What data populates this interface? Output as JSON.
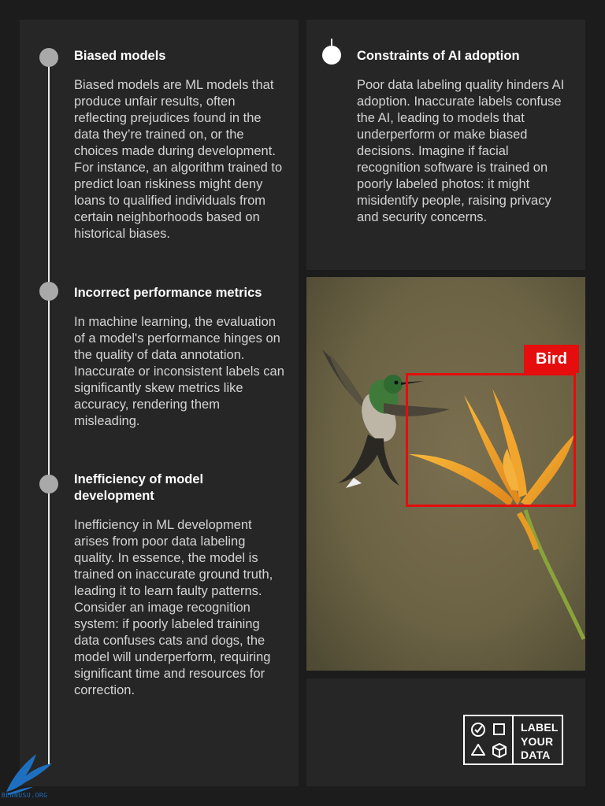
{
  "colors": {
    "background": "#1c1c1c",
    "panel": "#262626",
    "timeline": "#e8e8e8",
    "dot": "#a9a9a9",
    "bbox_red": "#e50d0d"
  },
  "timeline": {
    "items": [
      {
        "heading": "Biased models",
        "body": "Biased models are ML models that produce unfair results, often reflecting prejudices found in the data they’re trained on, or the choices made during development. For instance, an algorithm trained to predict loan riskiness might deny loans to qualified individuals from certain neighborhoods based on historical biases."
      },
      {
        "heading": "Incorrect performance metrics",
        "body": "In machine learning, the evaluation of a model's performance hinges on the quality of data annotation. Inaccurate or inconsistent labels can significantly skew metrics like accuracy, rendering them misleading."
      },
      {
        "heading": "Inefficiency of model development",
        "body": "Inefficiency in ML development arises from poor data labeling quality. In essence, the model is trained on inaccurate ground truth, leading it to learn faulty patterns. Consider an image recognition system: if poorly labeled training data confuses cats and dogs, the model will underperform, requiring significant time and resources for correction."
      },
      {
        "heading": "Constraints of AI adoption",
        "body": "Poor data labeling quality hinders AI adoption. Inaccurate labels confuse the AI, leading to models that underperform or make biased decisions. Imagine if facial recognition software is trained on poorly labeled photos: it might misidentify people, raising privacy and security concerns."
      }
    ]
  },
  "photo": {
    "label": "Bird"
  },
  "logo": {
    "lines": [
      "LABEL",
      "YOUR",
      "DATA"
    ],
    "icons": [
      "check-circle-icon",
      "square-icon",
      "triangle-icon",
      "cube-icon"
    ]
  },
  "watermark": {
    "text": "BENNUSU.ORG"
  }
}
